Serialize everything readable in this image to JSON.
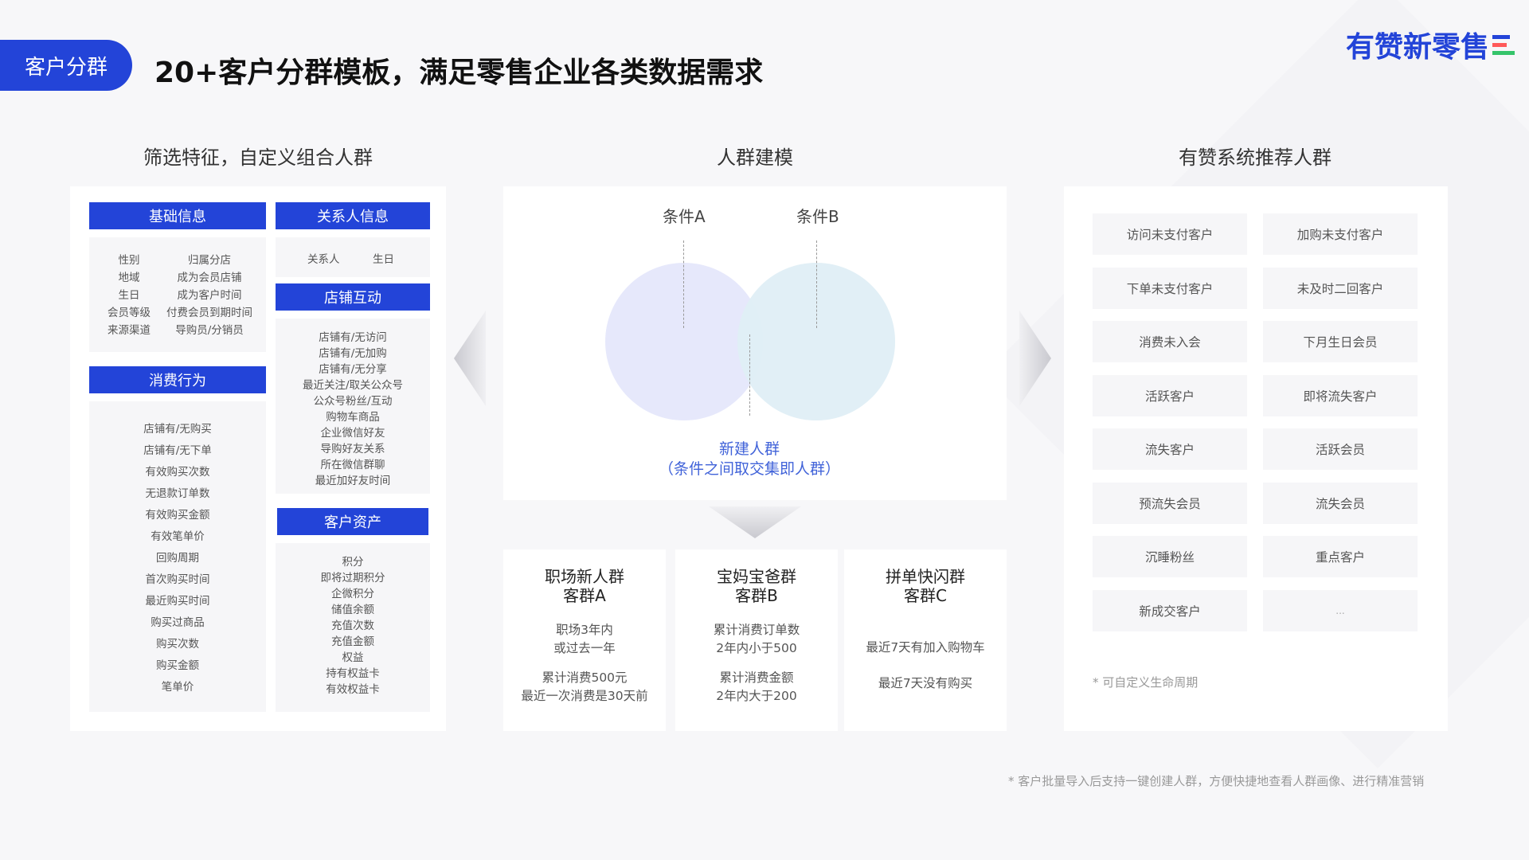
{
  "header": {
    "tag": "客户分群",
    "title": "20+客户分群模板，满足零售企业各类数据需求",
    "logo": "有赞新零售",
    "logo_colors": [
      "#2344d8",
      "#ff5a5a",
      "#35c46a"
    ]
  },
  "sections": {
    "left_title": "筛选特征，自定义组合人群",
    "middle_title": "人群建模",
    "right_title": "有赞系统推荐人群"
  },
  "filters": {
    "basic": {
      "title": "基础信息",
      "left_items": [
        "性别",
        "地域",
        "生日",
        "会员等级",
        "来源渠道"
      ],
      "right_items": [
        "归属分店",
        "成为会员店铺",
        "成为客户时间",
        "付费会员到期时间",
        "导购员/分销员"
      ]
    },
    "contact": {
      "title": "关系人信息",
      "items": [
        "关系人",
        "生日"
      ]
    },
    "consume": {
      "title": "消费行为",
      "items": [
        "店铺有/无购买",
        "店铺有/无下单",
        "有效购买次数",
        "无退款订单数",
        "有效购买金额",
        "有效笔单价",
        "回购周期",
        "首次购买时间",
        "最近购买时间",
        "购买过商品",
        "购买次数",
        "购买金额",
        "笔单价"
      ]
    },
    "interact": {
      "title": "店铺互动",
      "items": [
        "店铺有/无访问",
        "店铺有/无加购",
        "店铺有/无分享",
        "最近关注/取关公众号",
        "公众号粉丝/互动",
        "购物车商品",
        "企业微信好友",
        "导购好友关系",
        "所在微信群聊",
        "最近加好友时间"
      ]
    },
    "assets": {
      "title": "客户资产",
      "items": [
        "积分",
        "即将过期积分",
        "企微积分",
        "储值余额",
        "充值次数",
        "充值金额",
        "权益",
        "持有权益卡",
        "有效权益卡"
      ]
    }
  },
  "venn": {
    "label_a": "条件A",
    "label_b": "条件B",
    "result_line1": "新建人群",
    "result_line2": "（条件之间取交集即人群）"
  },
  "groups": [
    {
      "title1": "职场新人群",
      "title2": "客群A",
      "desc1": [
        "职场3年内",
        "或过去一年"
      ],
      "desc2": [
        "累计消费500元",
        "最近一次消费是30天前"
      ]
    },
    {
      "title1": "宝妈宝爸群",
      "title2": "客群B",
      "desc1": [
        "累计消费订单数",
        "2年内小于500"
      ],
      "desc2": [
        "累计消费金额",
        "2年内大于200"
      ]
    },
    {
      "title1": "拼单快闪群",
      "title2": "客群C",
      "desc1": [
        "最近7天有加入购物车"
      ],
      "desc2": [
        "最近7天没有购买"
      ]
    }
  ],
  "recommend": {
    "items": [
      "访问未支付客户",
      "加购未支付客户",
      "下单未支付客户",
      "未及时二回客户",
      "消费未入会",
      "下月生日会员",
      "活跃客户",
      "即将流失客户",
      "流失客户",
      "活跃会员",
      "预流失会员",
      "流失会员",
      "沉睡粉丝",
      "重点客户",
      "新成交客户",
      "..."
    ],
    "note": "* 可自定义生命周期"
  },
  "footer": "* 客户批量导入后支持一键创建人群，方便快捷地查看人群画像、进行精准营销"
}
